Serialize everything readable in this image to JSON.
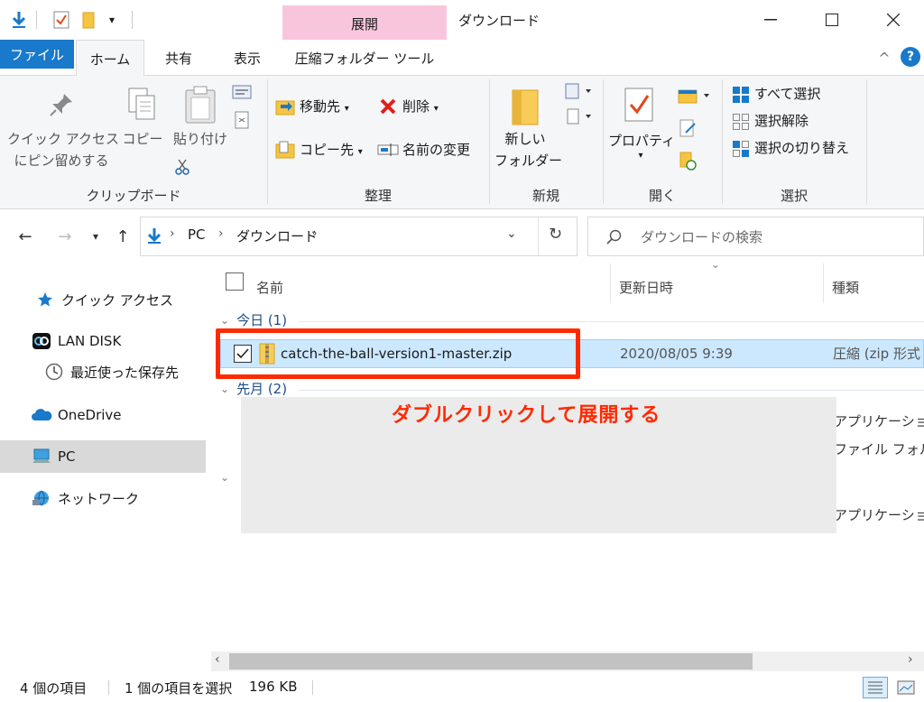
{
  "window": {
    "title": "ダウンロード",
    "context_tab_group": "展開"
  },
  "ribbon_tabs": [
    "ファイル",
    "ホーム",
    "共有",
    "表示",
    "圧縮フォルダー ツール"
  ],
  "ribbon": {
    "clipboard": {
      "pin_line1": "クイック アクセス",
      "pin_line2": "にピン留めする",
      "copy": "コピー",
      "paste": "貼り付け",
      "label": "クリップボード"
    },
    "organize": {
      "move_to": "移動先",
      "copy_to": "コピー先",
      "delete": "削除",
      "rename": "名前の変更",
      "label": "整理"
    },
    "new": {
      "new_folder_line1": "新しい",
      "new_folder_line2": "フォルダー",
      "label": "新規"
    },
    "open": {
      "properties": "プロパティ",
      "label": "開く"
    },
    "select": {
      "select_all": "すべて選択",
      "select_none": "選択解除",
      "invert": "選択の切り替え",
      "label": "選択"
    }
  },
  "address": {
    "path": [
      "PC",
      "ダウンロード"
    ],
    "search_placeholder": "ダウンロードの検索"
  },
  "sidebar": {
    "items": [
      "クイック アクセス",
      "LAN DISK",
      "最近使った保存先",
      "OneDrive",
      "PC",
      "ネットワーク"
    ]
  },
  "list": {
    "columns": [
      "名前",
      "更新日時",
      "種類"
    ],
    "groups": [
      {
        "label": "今日 (1)"
      },
      {
        "label": "先月 (2)"
      }
    ],
    "selected_file": {
      "name": "catch-the-ball-version1-master.zip",
      "date": "2020/08/05 9:39",
      "type": "圧縮 (zip 形式"
    },
    "partial_types": [
      "アプリケーション",
      "ファイル フォルダ",
      "アプリケーション"
    ]
  },
  "annotation": {
    "text": "ダブルクリックして展開する",
    "color": "#ff2a00"
  },
  "status": {
    "item_count": "4 個の項目",
    "selected": "1 個の項目を選択",
    "size": "196 KB"
  },
  "colors": {
    "file_tab": "#1979ca",
    "context_tab": "#f8c6dc",
    "selection": "#cce8ff"
  }
}
